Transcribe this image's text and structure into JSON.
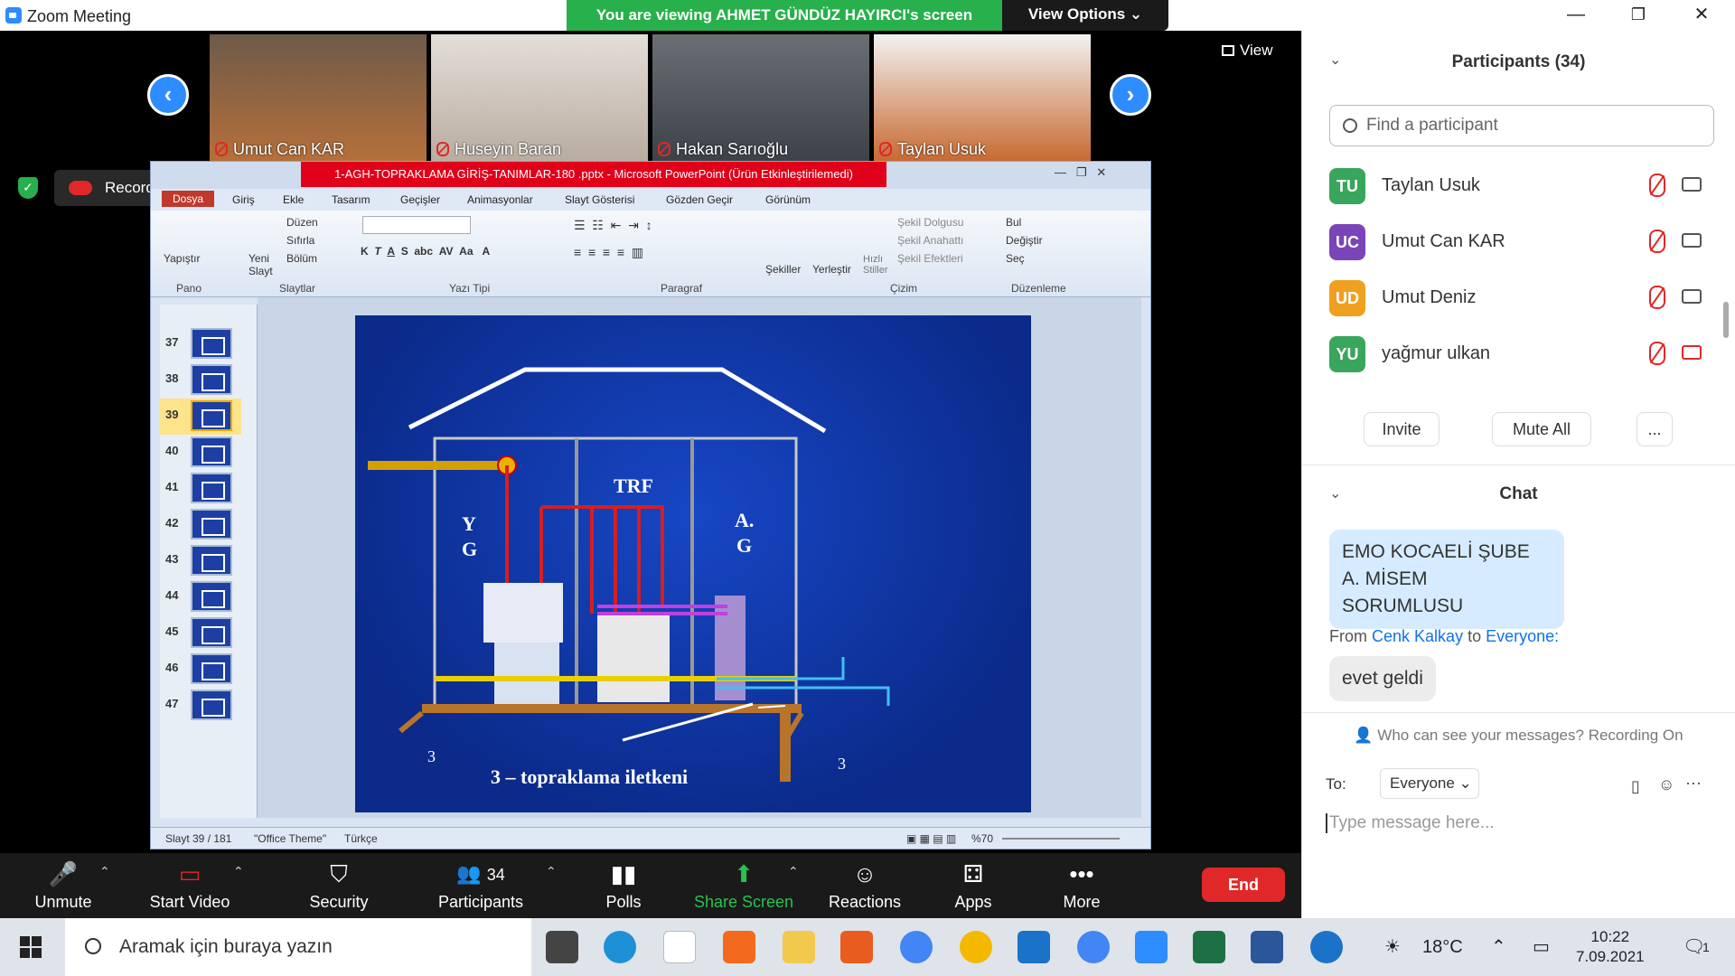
{
  "window": {
    "title": "Zoom Meeting",
    "share_banner": "You are viewing AHMET GÜNDÜZ HAYIRCI's screen",
    "view_options": "View Options ⌄",
    "minimize": "—",
    "restore": "❐",
    "close": "✕"
  },
  "videos": [
    {
      "name": "Umut Can KAR"
    },
    {
      "name": "Huseyin Baran"
    },
    {
      "name": "Hakan Sarıoğlu"
    },
    {
      "name": "Taylan Usuk"
    }
  ],
  "view_button": "View",
  "recording": "Recording...",
  "powerpoint": {
    "title": "1-AGH-TOPRAKLAMA GİRİŞ-TANIMLAR-180 .pptx - Microsoft PowerPoint (Ürün Etkinleştirilemedi)",
    "tabs": [
      "Dosya",
      "Giriş",
      "Ekle",
      "Tasarım",
      "Geçişler",
      "Animasyonlar",
      "Slayt Gösterisi",
      "Gözden Geçir",
      "Görünüm"
    ],
    "groups": [
      "Pano",
      "Slaytlar",
      "Yazı Tipi",
      "Paragraf",
      "Çizim",
      "Düzenleme"
    ],
    "ribbon": {
      "yapistir": "Yapıştır",
      "yeni_slayt": "Yeni Slayt",
      "duzen": "Düzen",
      "sifirla": "Sıfırla",
      "bolum": "Bölüm",
      "sekiller": "Şekiller",
      "yerlestir": "Yerleştir",
      "hizli_stiller": "Hızlı Stiller",
      "sekil_dolgusu": "Şekil Dolgusu",
      "sekil_anahatti": "Şekil Anahattı",
      "sekil_efektleri": "Şekil Efektleri",
      "bul": "Bul",
      "degistir": "Değiştir",
      "sec": "Seç"
    },
    "slide_numbers": [
      "37",
      "38",
      "39",
      "40",
      "41",
      "42",
      "43",
      "44",
      "45",
      "46",
      "47"
    ],
    "selected_slide": "39",
    "slide": {
      "trf": "TRF",
      "yg_1": "Y",
      "yg_2": "G",
      "ag_1": "A.",
      "ag_2": "G",
      "label_3a": "3",
      "label_3b": "3",
      "caption": "3 – topraklama iletkeni"
    },
    "status": {
      "slide_count": "Slayt 39 / 181",
      "theme": "\"Office Theme\"",
      "language": "Türkçe",
      "zoom": "%70"
    }
  },
  "toolbar": {
    "unmute": "Unmute",
    "start_video": "Start Video",
    "security": "Security",
    "participants": "Participants",
    "participant_count": "34",
    "polls": "Polls",
    "share_screen": "Share Screen",
    "reactions": "Reactions",
    "apps": "Apps",
    "more": "More",
    "end": "End"
  },
  "panel": {
    "participants_title": "Participants (34)",
    "search_placeholder": "Find a participant",
    "participants": [
      {
        "initials": "TU",
        "name": "Taylan Usuk",
        "color": "#3aa55d"
      },
      {
        "initials": "UC",
        "name": "Umut Can KAR",
        "color": "#7b44b8"
      },
      {
        "initials": "UD",
        "name": "Umut Deniz",
        "color": "#f0a020"
      },
      {
        "initials": "YU",
        "name": "yağmur ulkan",
        "color": "#3aa55d"
      }
    ],
    "invite": "Invite",
    "mute_all": "Mute All",
    "more_btn": "...",
    "chat_title": "Chat",
    "message1": "EMO KOCAELİ ŞUBE A. MİSEM SORUMLUSU",
    "from_prefix": "From",
    "from_sender": "Cenk Kalkay",
    "from_to": "to",
    "from_target": "Everyone:",
    "message2": "evet geldi",
    "who_can_see": "Who can see your messages? Recording On",
    "to_label": "To:",
    "to_value": "Everyone ⌄",
    "input_placeholder": "Type message here..."
  },
  "taskbar": {
    "search_text": "Aramak için buraya yazın",
    "weather": "18°C",
    "time": "10:22",
    "date": "7.09.2021",
    "notif_count": "1"
  }
}
